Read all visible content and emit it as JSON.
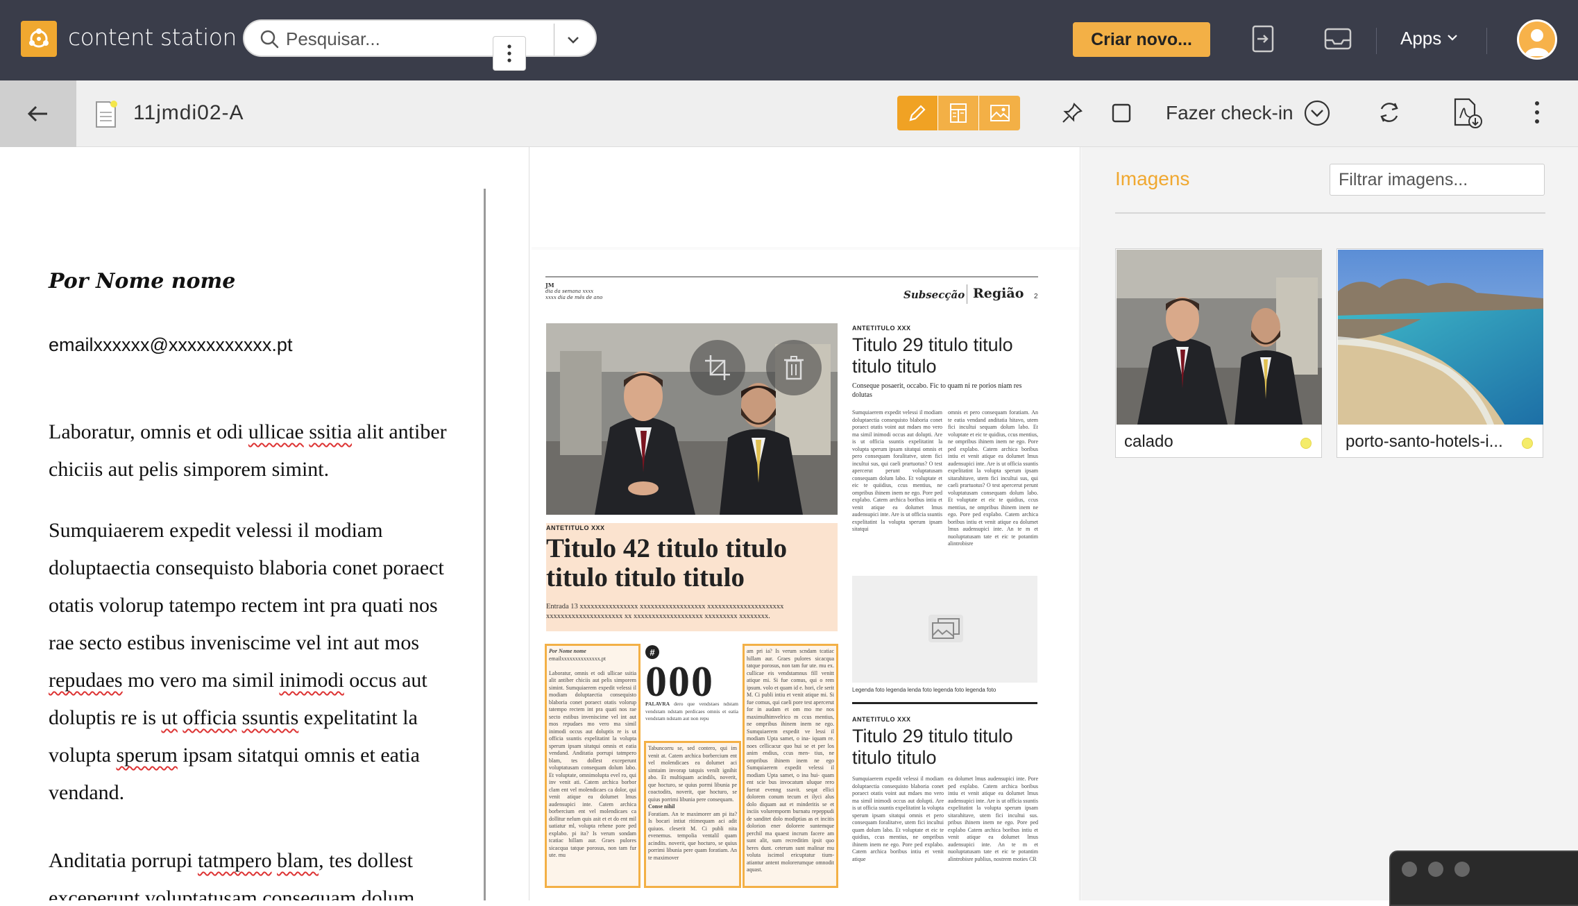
{
  "topbar": {
    "app_title": "content station",
    "search_placeholder": "Pesquisar...",
    "create_label": "Criar novo...",
    "apps_label": "Apps",
    "colors": {
      "background": "#3a3d4a",
      "accent": "#f3b046"
    }
  },
  "document": {
    "name": "11jmdi02-A",
    "checkin_label": "Fazer check-in"
  },
  "editor": {
    "byline": "Por Nome nome",
    "email": "emailxxxxxx@xxxxxxxxxxx.pt"
  },
  "page": {
    "masthead_small": "JM",
    "masthead_date": "dia da semana xxxx",
    "masthead_date2": "xxxx dia de mês de ano",
    "section": "Subsecção",
    "region": "Região",
    "page_number": "2",
    "main_kicker": "ANTETITULO XXX",
    "main_headline": "Titulo 42 titulo titulo titulo titulo titulo",
    "main_lead": "Entrada 13 xxxxxxxxxxxxxxxx xxxxxxxxxxxxxxxxxx xxxxxxxxxxxxxxxxxxxxx xxxxxxxxxxxxxxxxxxxxx xx xxxxxxxxxxxxxxxxxxx xxxxxxxxx xxxxxxxx.",
    "side_kicker": "ANTETITULO XXX",
    "side_headline": "Titulo 29 titulo titulo titulo titulo",
    "side_sub": "Conseque posaerit, occabo. Fic to quam ni re porios niam res dolutas",
    "caption": "Legenda foto legenda lenda foto legenda foto legenda foto",
    "bottom_kicker": "ANTETITULO XXX",
    "bottom_headline": "Titulo 29 titulo titulo titulo titulo",
    "box_number": "000",
    "box_hash": "#",
    "box_word": "PALAVRA",
    "col_byline": "Por Nome nome"
  },
  "images_panel": {
    "title": "Imagens",
    "filter_placeholder": "Filtrar imagens...",
    "items": [
      {
        "label": "calado",
        "status_color": "#f4ec6a"
      },
      {
        "label": "porto-santo-hotels-i...",
        "status_color": "#f4ec6a"
      }
    ]
  },
  "icons": {
    "logo": "content-station-logo-icon",
    "search": "search-icon",
    "back": "arrow-left-icon",
    "pencil": "pencil-icon",
    "layout": "layout-icon",
    "image": "image-icon",
    "pin": "pin-icon",
    "checkbox": "square-icon",
    "refresh": "refresh-icon",
    "pdf": "pdf-download-icon",
    "more": "more-vertical-icon",
    "crop": "crop-icon",
    "trash": "trash-icon"
  }
}
